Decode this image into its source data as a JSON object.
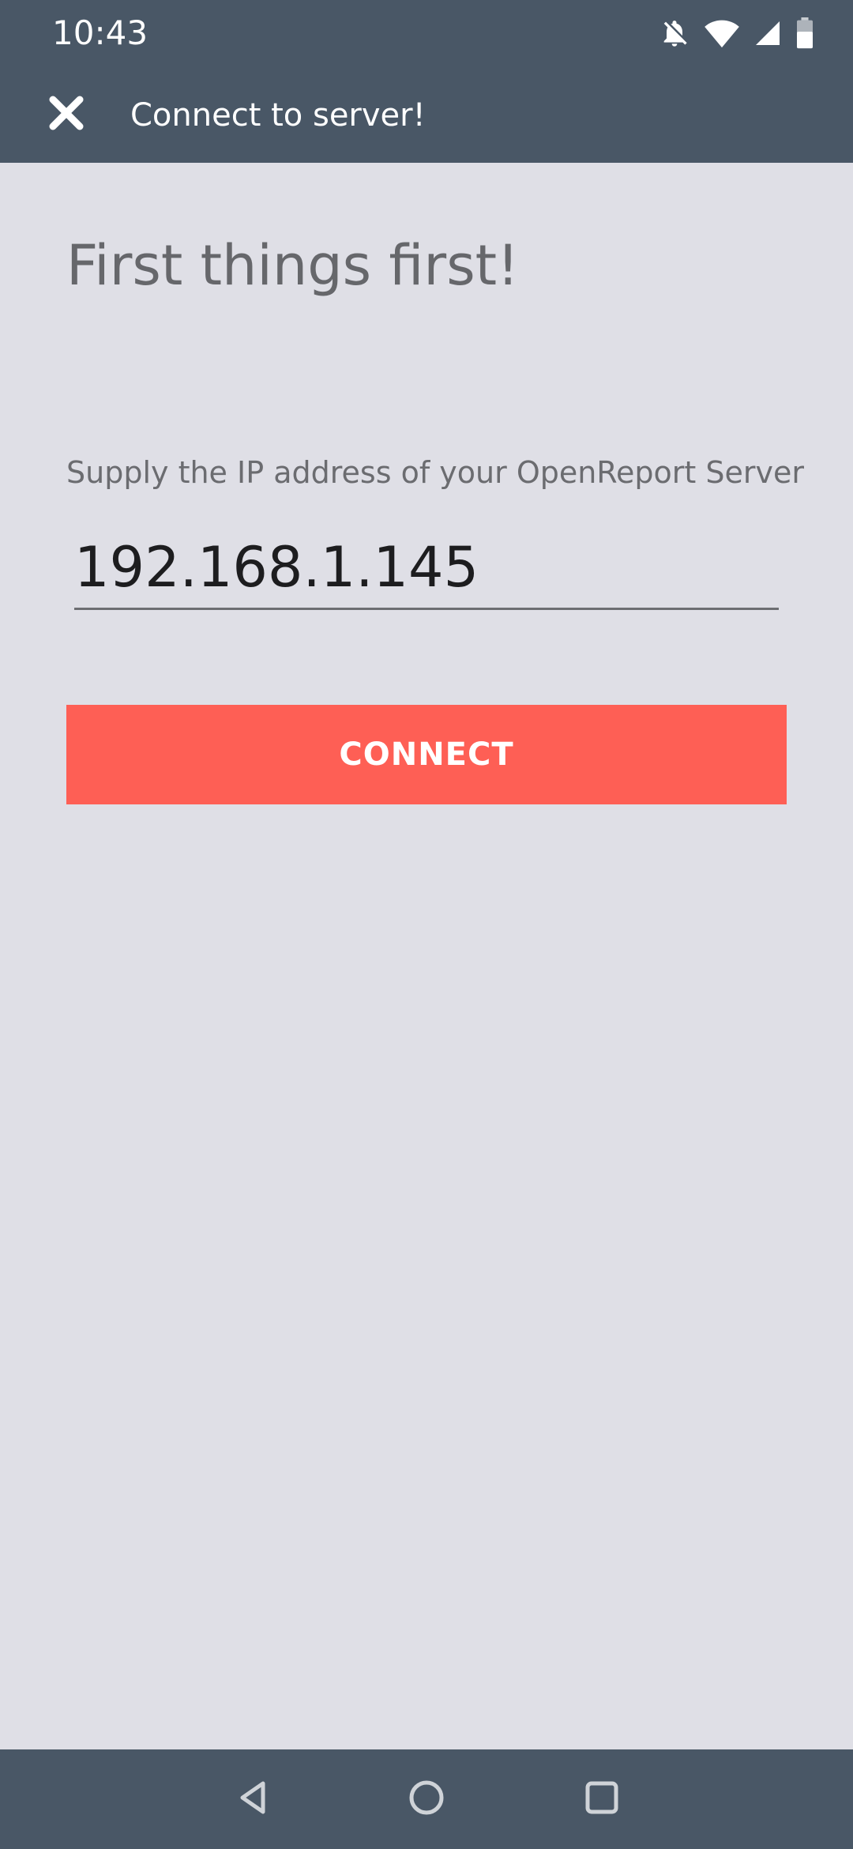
{
  "status_bar": {
    "time": "10:43",
    "icons": [
      "notifications-off-icon",
      "wifi-icon",
      "cell-signal-icon",
      "battery-icon"
    ]
  },
  "app_bar": {
    "close_icon": "close-icon",
    "title": "Connect to server!"
  },
  "content": {
    "heading": "First things first!",
    "ip_label": "Supply the IP address of your OpenReport Server",
    "ip_value": "192.168.1.145",
    "connect_label": "CONNECT"
  },
  "nav_bar": {
    "icons": [
      "back-icon",
      "home-icon",
      "recents-icon"
    ]
  },
  "colors": {
    "bar": "#495766",
    "background": "#dfdfe6",
    "accent": "#fe5f55"
  }
}
